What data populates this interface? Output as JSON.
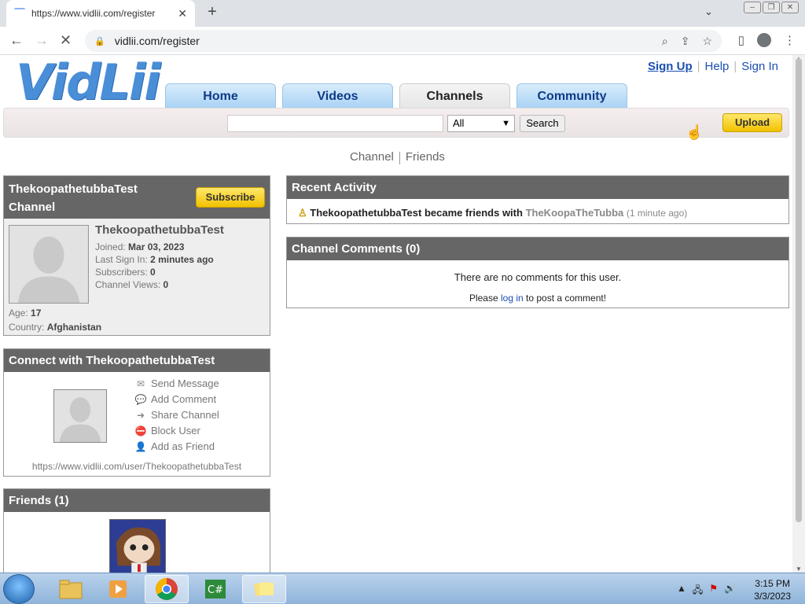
{
  "browser": {
    "tab_title": "https://www.vidlii.com/register",
    "url": "vidlii.com/register"
  },
  "site": {
    "logo": "VidLii",
    "top_links": {
      "signup": "Sign Up",
      "help": "Help",
      "signin": "Sign In"
    },
    "nav": [
      "Home",
      "Videos",
      "Channels",
      "Community"
    ],
    "active_nav": "Channels",
    "search": {
      "category": "All",
      "button": "Search",
      "value": ""
    },
    "upload": "Upload"
  },
  "subnav": {
    "channel": "Channel",
    "friends": "Friends"
  },
  "profile": {
    "header_line1": "ThekoopathetubbaTest",
    "header_line2": "Channel",
    "subscribe": "Subscribe",
    "username": "ThekoopathetubbaTest",
    "joined_label": "Joined:",
    "joined": "Mar 03, 2023",
    "lastsignin_label": "Last Sign In:",
    "lastsignin": "2 minutes ago",
    "subscribers_label": "Subscribers:",
    "subscribers": "0",
    "views_label": "Channel Views:",
    "views": "0",
    "age_label": "Age:",
    "age": "17",
    "country_label": "Country:",
    "country": "Afghanistan"
  },
  "connect": {
    "title": "Connect with ThekoopathetubbaTest",
    "links": [
      "Send Message",
      "Add Comment",
      "Share Channel",
      "Block User",
      "Add as Friend"
    ],
    "url": "https://www.vidlii.com/user/ThekoopathetubbaTest"
  },
  "friends": {
    "title": "Friends (1)"
  },
  "recent": {
    "title": "Recent Activity",
    "user": "ThekoopathetubbaTest",
    "action": "became friends with",
    "friend": "TheKoopaTheTubba",
    "time": "(1 minute ago)"
  },
  "comments": {
    "title": "Channel Comments (0)",
    "none": "There are no comments for this user.",
    "please": "Please",
    "login": "log in",
    "post": "to post a comment!"
  },
  "taskbar": {
    "time": "3:15 PM",
    "date": "3/3/2023"
  }
}
